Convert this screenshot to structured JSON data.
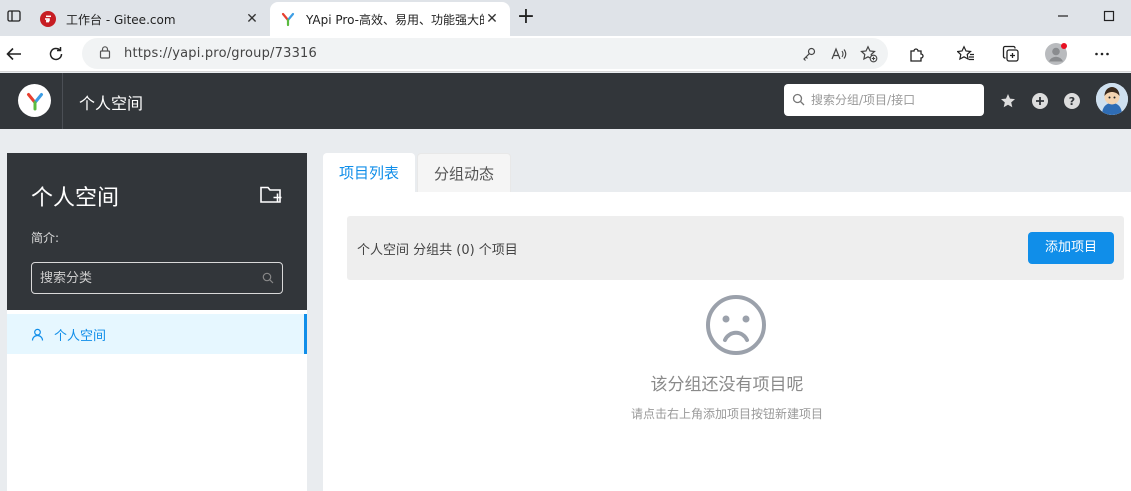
{
  "browser": {
    "tabs": [
      {
        "title": "工作台 - Gitee.com",
        "favicon": "gitee-logo-icon",
        "active": false
      },
      {
        "title": "YApi Pro-高效、易用、功能强大的",
        "favicon": "yapi-logo-icon",
        "active": true
      }
    ],
    "address": {
      "url": "https://yapi.pro/group/73316"
    },
    "toolbar_icons": [
      "key-icon",
      "read-aloud-icon",
      "add-favorite-icon",
      "extensions-icon",
      "favorites-icon",
      "collections-icon",
      "profile-icon",
      "more-icon"
    ]
  },
  "header": {
    "title": "个人空间",
    "search": {
      "placeholder": "搜索分组/项目/接口"
    },
    "icons": [
      "star-icon",
      "plus-circle-icon",
      "help-circle-icon",
      "user-avatar"
    ]
  },
  "sidebar": {
    "group_name": "个人空间",
    "desc_label": "简介:",
    "search": {
      "placeholder": "搜索分类"
    },
    "items": [
      {
        "label": "个人空间",
        "icon": "user-icon"
      }
    ]
  },
  "main": {
    "tabs": [
      {
        "label": "项目列表",
        "active": true
      },
      {
        "label": "分组动态",
        "active": false
      }
    ],
    "summary": "个人空间 分组共 (0) 个项目",
    "add_button": "添加项目",
    "empty_title": "该分组还没有项目呢",
    "empty_desc": "请点击右上角添加项目按钮新建项目"
  },
  "colors": {
    "primary": "#108ee9",
    "header_bg": "#32363a",
    "page_bg": "#e9ecef"
  }
}
